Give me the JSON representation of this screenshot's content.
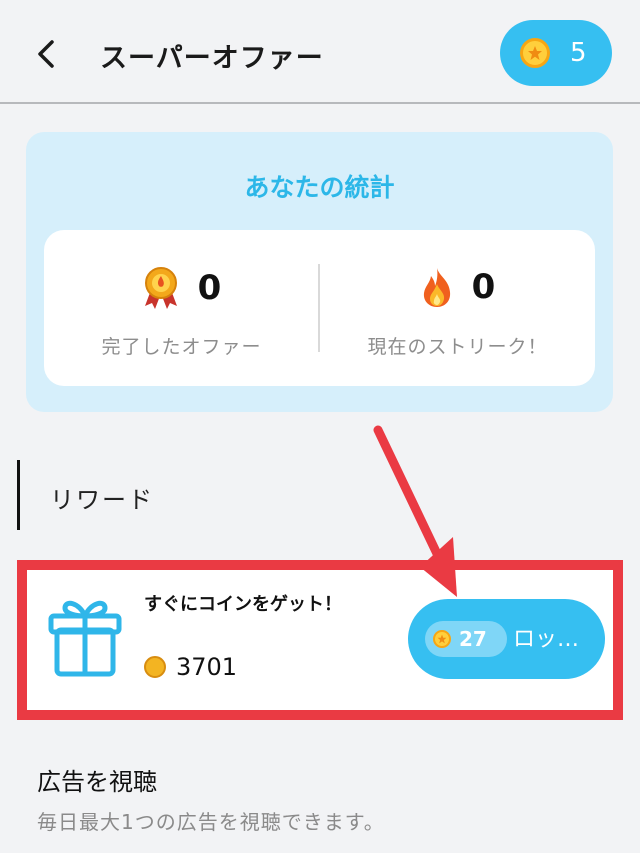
{
  "header": {
    "title": "スーパーオファー",
    "coin_balance": "5"
  },
  "stats": {
    "title": "あなたの統計",
    "completed": {
      "value": "0",
      "label": "完了したオファー"
    },
    "streak": {
      "value": "0",
      "label": "現在のストリーク！"
    }
  },
  "rewards_section": {
    "title": "リワード"
  },
  "reward_offer": {
    "title": "すぐにコインをゲット！",
    "coins": "3701",
    "cost": "27",
    "button_label": "ロック解除"
  },
  "watch_ad": {
    "title": "広告を視聴",
    "subtitle": "毎日最大1つの広告を視聴できます。"
  },
  "colors": {
    "accent": "#36bff1",
    "stats_bg": "#d6effb",
    "highlight": "#ea3a43"
  }
}
